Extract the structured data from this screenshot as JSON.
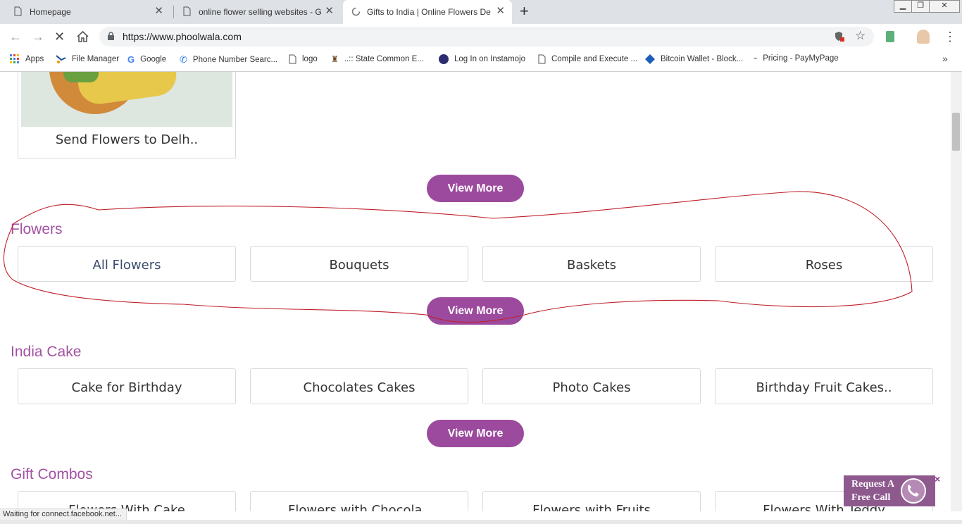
{
  "browser": {
    "tabs": [
      {
        "title": "Homepage",
        "active": false
      },
      {
        "title": "online flower selling websites - Goog",
        "active": false
      },
      {
        "title": "Gifts to India | Online Flowers Delive",
        "active": true
      }
    ],
    "new_tab": "+",
    "url": "https://www.phoolwala.com",
    "bookmarks": [
      {
        "label": "Apps",
        "icon": "apps-grid-icon"
      },
      {
        "label": "File Manager",
        "icon": "file-manager-icon"
      },
      {
        "label": "Google",
        "icon": "google-icon"
      },
      {
        "label": "Phone Number Searc...",
        "icon": "phone-icon"
      },
      {
        "label": "logo",
        "icon": "page-icon"
      },
      {
        "label": "..:: State Common E...",
        "icon": "emblem-icon"
      },
      {
        "label": "Log In on Instamojo",
        "icon": "instamojo-icon"
      },
      {
        "label": "Compile and Execute ...",
        "icon": "page-icon"
      },
      {
        "label": "Bitcoin Wallet - Block...",
        "icon": "blockchain-icon"
      },
      {
        "label": "Pricing - PayMyPage",
        "icon": "paymypage-icon"
      }
    ],
    "overflow": "»",
    "status_text": "Waiting for connect.facebook.net..."
  },
  "page": {
    "top_card_label": "Send Flowers to Delh..",
    "view_more_label": "View More",
    "sections": [
      {
        "title": "Flowers",
        "items": [
          "All Flowers",
          "Bouquets",
          "Baskets",
          "Roses"
        ]
      },
      {
        "title": "India Cake",
        "items": [
          "Cake for Birthday",
          "Chocolates Cakes",
          "Photo Cakes",
          "Birthday Fruit Cakes.."
        ]
      },
      {
        "title": "Gift Combos",
        "items": [
          "Flowers With Cake",
          "Flowers with Chocola..",
          "Flowers with Fruits",
          "Flowers With Teddy"
        ]
      }
    ],
    "request_call": {
      "line1": "Request A",
      "line2": "Free Call",
      "close": "×"
    }
  },
  "colors": {
    "accent_purple": "#9c4a9e",
    "section_title": "#a352a3",
    "annotation_red": "#c0202a"
  }
}
